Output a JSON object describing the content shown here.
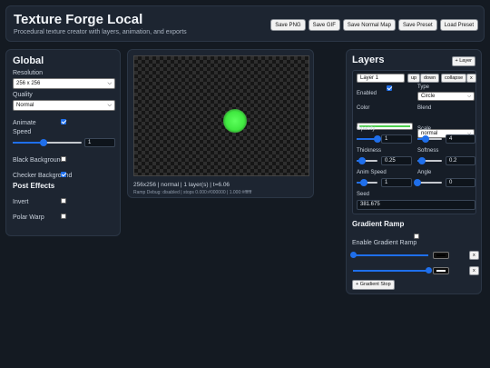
{
  "header": {
    "title": "Texture Forge Local",
    "subtitle": "Procedural texture creator with layers, animation, and exports",
    "buttons": [
      "Save PNG",
      "Save GIF",
      "Save Normal Map",
      "Save Preset",
      "Load Preset"
    ]
  },
  "global": {
    "title": "Global",
    "resolution_label": "Resolution",
    "resolution_value": "256 x 256",
    "quality_label": "Quality",
    "quality_value": "Normal",
    "animate_label": "Animate",
    "animate_checked": true,
    "speed_label": "Speed",
    "speed_value": "1",
    "speed_fraction": 0.45,
    "black_bg_label": "Black Background",
    "black_bg_checked": false,
    "checker_bg_label": "Checker Background",
    "checker_bg_checked": true,
    "post_effects_title": "Post Effects",
    "invert_label": "Invert",
    "invert_checked": false,
    "polar_warp_label": "Polar Warp",
    "polar_warp_checked": false
  },
  "canvas": {
    "status": "256x256 | normal | 1 layer(s) | t=6.06",
    "debug": "Ramp Debug: disabled | stops 0.000:#000000 | 1.000:#ffffff",
    "blob_color": "#4cf54c"
  },
  "layers": {
    "title": "Layers",
    "add_label": "+ Layer",
    "name_value": "Layer 1",
    "up_label": "up",
    "down_label": "down",
    "collapse_label": "collapse",
    "remove_label": "x",
    "enabled_label": "Enabled",
    "enabled_checked": true,
    "type_label": "Type",
    "type_value": "Circle",
    "color_label": "Color",
    "color_value": "#4fd14f",
    "blend_label": "Blend",
    "blend_value": "normal",
    "opacity_label": "Opacity",
    "opacity_value": "1",
    "opacity_fraction": 1.0,
    "scale_label": "Scale",
    "scale_value": "4",
    "scale_fraction": 0.35,
    "thickness_label": "Thickness",
    "thickness_value": "0.25",
    "thickness_fraction": 0.25,
    "softness_label": "Softness",
    "softness_value": "0.2",
    "softness_fraction": 0.2,
    "anim_speed_label": "Anim Speed",
    "anim_speed_value": "1",
    "anim_speed_fraction": 0.35,
    "angle_label": "Angle",
    "angle_value": "0",
    "angle_fraction": 0.0,
    "seed_label": "Seed",
    "seed_value": "381.675"
  },
  "gradient": {
    "title": "Gradient Ramp",
    "enable_label": "Enable Gradient Ramp",
    "enable_checked": false,
    "stops": [
      {
        "position": 0.0,
        "color": "#000000",
        "remove_label": "x"
      },
      {
        "position": 1.0,
        "color": "#ffffff",
        "remove_label": "x"
      }
    ],
    "add_stop_label": "+ Gradient Stop"
  }
}
